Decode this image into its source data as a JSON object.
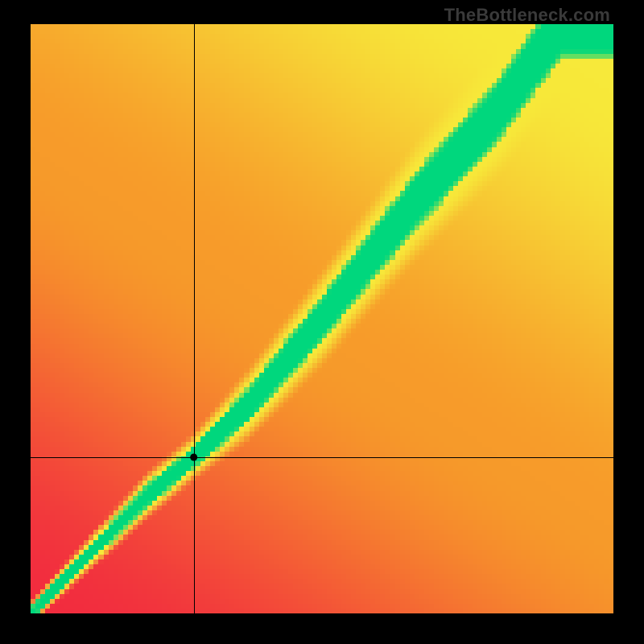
{
  "watermark": "TheBottleneck.com",
  "colors": {
    "frame_bg": "#000000",
    "crosshair": "#000000",
    "red": "#f22c3f",
    "orange": "#f79b2a",
    "yellow": "#f7e93a",
    "green": "#00d77d",
    "dot": "#000000"
  },
  "chart_data": {
    "type": "heatmap",
    "title": "",
    "xlabel": "",
    "ylabel": "",
    "xlim": [
      0,
      100
    ],
    "ylim": [
      0,
      100
    ],
    "grid_resolution": 120,
    "colormap_description": "red → orange → yellow at extremes, green along the optimal ridge",
    "ridge": {
      "description": "approx. green optimal band running diagonally; piecewise center line (x, y) in percent of plot extent",
      "center_points_pct": [
        [
          0,
          0
        ],
        [
          10,
          10
        ],
        [
          20,
          20
        ],
        [
          28,
          26.5
        ],
        [
          37,
          35
        ],
        [
          50,
          50
        ],
        [
          66,
          70
        ],
        [
          80,
          85
        ],
        [
          91,
          100
        ]
      ],
      "half_width_pct_at_points": [
        1.0,
        1.5,
        2.0,
        2.0,
        3.0,
        4.0,
        5.0,
        5.5,
        6.0
      ]
    },
    "crosshair_pct": {
      "x": 28.0,
      "y": 26.5
    },
    "marker_pct": {
      "x": 28.0,
      "y": 26.5
    },
    "corner_hues": {
      "top_left": "red",
      "top_right": "yellow",
      "bottom_left": "red",
      "bottom_right": "red"
    }
  }
}
